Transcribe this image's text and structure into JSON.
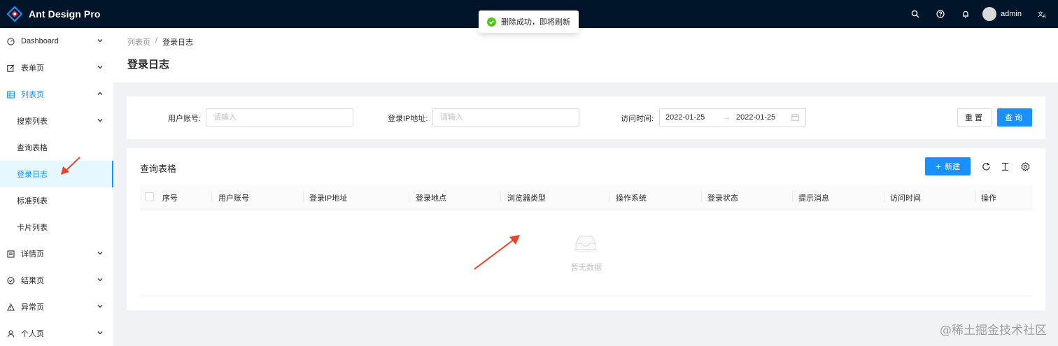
{
  "app": {
    "title": "Ant Design Pro"
  },
  "header": {
    "username": "admin"
  },
  "toast": {
    "text": "删除成功，即将刷新"
  },
  "sidebar": {
    "items": [
      {
        "label": "Dashboard"
      },
      {
        "label": "表单页"
      },
      {
        "label": "列表页"
      },
      {
        "label": "搜索列表"
      },
      {
        "label": "查询表格"
      },
      {
        "label": "登录日志"
      },
      {
        "label": "标准列表"
      },
      {
        "label": "卡片列表"
      },
      {
        "label": "详情页"
      },
      {
        "label": "结果页"
      },
      {
        "label": "异常页"
      },
      {
        "label": "个人页"
      }
    ]
  },
  "breadcrumb": {
    "parent": "列表页",
    "separator": "/",
    "current": "登录日志"
  },
  "page": {
    "title": "登录日志"
  },
  "search": {
    "account_label": "用户账号:",
    "account_placeholder": "请输入",
    "ip_label": "登录IP地址:",
    "ip_placeholder": "请输入",
    "time_label": "访问时间:",
    "date_start": "2022-01-25",
    "date_sep": "→",
    "date_end": "2022-01-25",
    "reset_label": "重置",
    "query_label": "查询"
  },
  "table": {
    "title": "查询表格",
    "new_label": "新建",
    "columns": [
      "序号",
      "用户账号",
      "登录IP地址",
      "登录地点",
      "浏览器类型",
      "操作系统",
      "登录状态",
      "提示消息",
      "访问时间",
      "操作"
    ],
    "empty_text": "暂无数据"
  },
  "watermark": "@稀土掘金技术社区",
  "colors": {
    "primary": "#1890ff",
    "header_bg": "#001529",
    "success": "#52c41a",
    "annotation": "#e8442e"
  }
}
